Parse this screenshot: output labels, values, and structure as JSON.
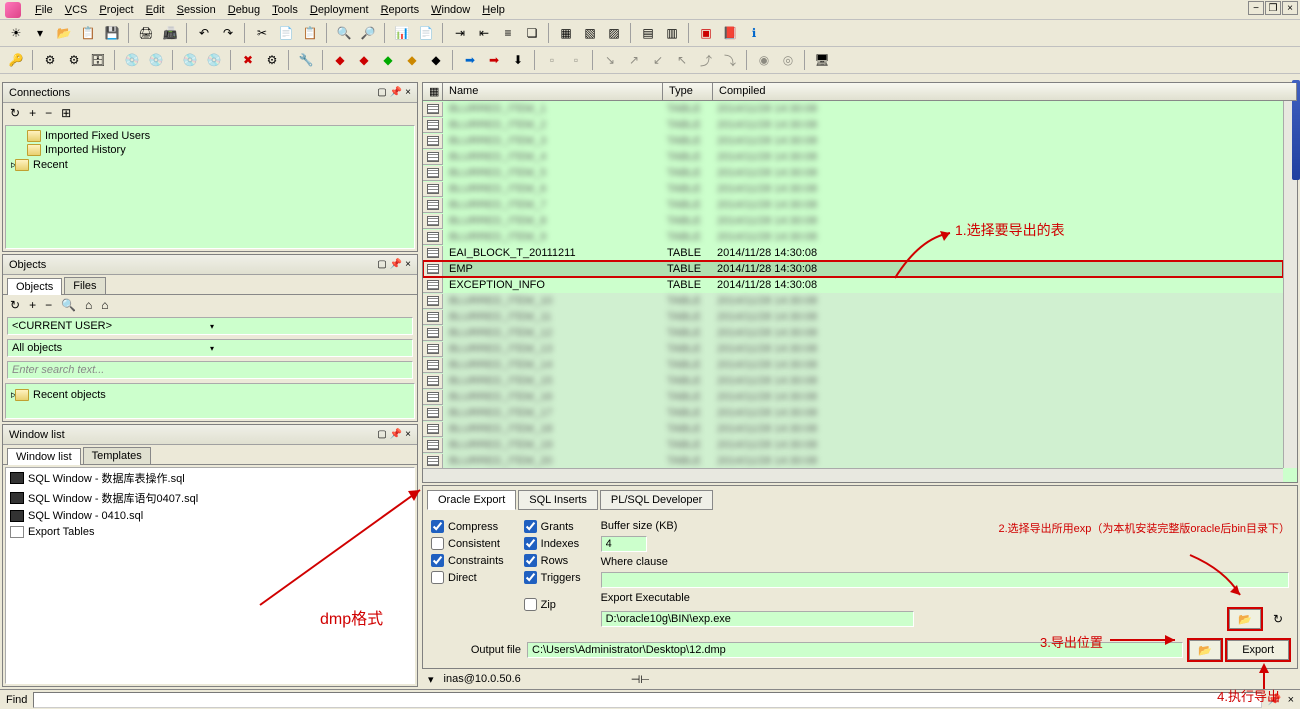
{
  "menubar": {
    "items": [
      "File",
      "VCS",
      "Project",
      "Edit",
      "Session",
      "Debug",
      "Tools",
      "Deployment",
      "Reports",
      "Window",
      "Help"
    ]
  },
  "connections": {
    "title": "Connections",
    "items": [
      "Imported Fixed Users",
      "Imported History",
      "Recent"
    ]
  },
  "objects": {
    "title": "Objects",
    "tabs": [
      "Objects",
      "Files"
    ],
    "current_user": "<CURRENT USER>",
    "all_objects": "All objects",
    "search_placeholder": "Enter search text...",
    "recent": "Recent objects"
  },
  "windowlist": {
    "title": "Window list",
    "tabs": [
      "Window list",
      "Templates"
    ],
    "items": [
      {
        "label": "SQL Window - 数据库表操作.sql",
        "type": "sql"
      },
      {
        "label": "SQL Window - 数据库语句0407.sql",
        "type": "sql"
      },
      {
        "label": "SQL Window - 0410.sql",
        "type": "sql"
      },
      {
        "label": "Export Tables",
        "type": "export"
      }
    ]
  },
  "grid": {
    "headers": {
      "name": "Name",
      "type": "Type",
      "compiled": "Compiled"
    },
    "rows": [
      {
        "name": "BLURRED_ITEM_1",
        "type": "TABLE",
        "compiled": "2014/11/28 14:30:08",
        "blur": true
      },
      {
        "name": "BLURRED_ITEM_2",
        "type": "TABLE",
        "compiled": "2014/11/28 14:30:08",
        "blur": true
      },
      {
        "name": "BLURRED_ITEM_3",
        "type": "TABLE",
        "compiled": "2014/11/28 14:30:08",
        "blur": true
      },
      {
        "name": "BLURRED_ITEM_4",
        "type": "TABLE",
        "compiled": "2014/11/28 14:30:08",
        "blur": true
      },
      {
        "name": "BLURRED_ITEM_5",
        "type": "TABLE",
        "compiled": "2014/11/28 14:30:08",
        "blur": true
      },
      {
        "name": "BLURRED_ITEM_6",
        "type": "TABLE",
        "compiled": "2014/11/28 14:30:08",
        "blur": true
      },
      {
        "name": "BLURRED_ITEM_7",
        "type": "TABLE",
        "compiled": "2014/11/28 14:30:08",
        "blur": true
      },
      {
        "name": "BLURRED_ITEM_8",
        "type": "TABLE",
        "compiled": "2014/11/28 14:30:08",
        "blur": true
      },
      {
        "name": "BLURRED_ITEM_9",
        "type": "TABLE",
        "compiled": "2014/11/28 14:30:08",
        "blur": true
      },
      {
        "name": "EAI_BLOCK_T_20111211",
        "type": "TABLE",
        "compiled": "2014/11/28 14:30:08",
        "blur": false
      },
      {
        "name": "EMP",
        "type": "TABLE",
        "compiled": "2014/11/28 14:30:08",
        "blur": false,
        "selected": true
      },
      {
        "name": "EXCEPTION_INFO",
        "type": "TABLE",
        "compiled": "2014/11/28 14:30:08",
        "blur": false
      },
      {
        "name": "BLURRED_ITEM_10",
        "type": "TABLE",
        "compiled": "2014/11/28 14:30:08",
        "blur": true
      },
      {
        "name": "BLURRED_ITEM_11",
        "type": "TABLE",
        "compiled": "2014/11/28 14:30:08",
        "blur": true
      },
      {
        "name": "BLURRED_ITEM_12",
        "type": "TABLE",
        "compiled": "2014/11/28 14:30:08",
        "blur": true
      },
      {
        "name": "BLURRED_ITEM_13",
        "type": "TABLE",
        "compiled": "2014/11/28 14:30:08",
        "blur": true
      },
      {
        "name": "BLURRED_ITEM_14",
        "type": "TABLE",
        "compiled": "2014/11/28 14:30:08",
        "blur": true
      },
      {
        "name": "BLURRED_ITEM_15",
        "type": "TABLE",
        "compiled": "2014/11/28 14:30:08",
        "blur": true
      },
      {
        "name": "BLURRED_ITEM_16",
        "type": "TABLE",
        "compiled": "2014/11/28 14:30:08",
        "blur": true
      },
      {
        "name": "BLURRED_ITEM_17",
        "type": "TABLE",
        "compiled": "2014/11/28 14:30:08",
        "blur": true
      },
      {
        "name": "BLURRED_ITEM_18",
        "type": "TABLE",
        "compiled": "2014/11/28 14:30:08",
        "blur": true
      },
      {
        "name": "BLURRED_ITEM_19",
        "type": "TABLE",
        "compiled": "2014/11/28 14:30:08",
        "blur": true
      },
      {
        "name": "BLURRED_ITEM_20",
        "type": "TABLE",
        "compiled": "2014/11/28 14:30:08",
        "blur": true
      }
    ]
  },
  "export": {
    "tabs": [
      "Oracle Export",
      "SQL Inserts",
      "PL/SQL Developer"
    ],
    "checks": {
      "compress": {
        "label": "Compress",
        "checked": true
      },
      "consistent": {
        "label": "Consistent",
        "checked": false
      },
      "constraints": {
        "label": "Constraints",
        "checked": true
      },
      "direct": {
        "label": "Direct",
        "checked": false
      },
      "grants": {
        "label": "Grants",
        "checked": true
      },
      "indexes": {
        "label": "Indexes",
        "checked": true
      },
      "rows": {
        "label": "Rows",
        "checked": true
      },
      "triggers": {
        "label": "Triggers",
        "checked": true
      },
      "zip": {
        "label": "Zip",
        "checked": false
      }
    },
    "buffer_label": "Buffer size (KB)",
    "buffer_value": "4",
    "where_label": "Where clause",
    "where_value": "",
    "exec_label": "Export Executable",
    "exec_value": "D:\\oracle10g\\BIN\\exp.exe",
    "output_label": "Output file",
    "output_value": "C:\\Users\\Administrator\\Desktop\\12.dmp",
    "export_btn": "Export"
  },
  "statusbar": {
    "connection": "inas@10.0.50.6"
  },
  "findbar": {
    "label": "Find"
  },
  "annotations": {
    "a1": "1.选择要导出的表",
    "a2": "2.选择导出所用exp（为本机安装完整版oracle后bin目录下）",
    "a3": "3.导出位置",
    "a4": "4.执行导出",
    "dmp": "dmp格式"
  }
}
